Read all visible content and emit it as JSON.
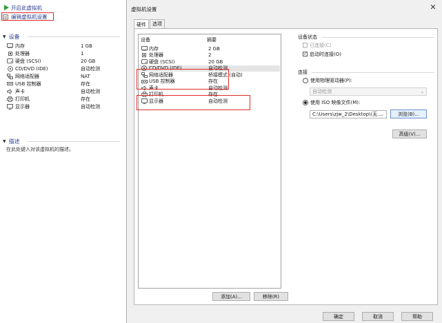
{
  "left": {
    "actions": {
      "power_on": "开启此虚拟机",
      "edit": "编辑虚拟机设置"
    },
    "devices_header": "设备",
    "devices": [
      {
        "icon": "memory-icon",
        "name": "内存",
        "value": "1 GB"
      },
      {
        "icon": "processor-icon",
        "name": "处理器",
        "value": "1"
      },
      {
        "icon": "hard-disk-icon",
        "name": "硬盘 (SCSI)",
        "value": "20 GB"
      },
      {
        "icon": "cd-dvd-icon",
        "name": "CD/DVD (IDE)",
        "value": "自动检测"
      },
      {
        "icon": "network-adapter-icon",
        "name": "网络适配器",
        "value": "NAT"
      },
      {
        "icon": "usb-icon",
        "name": "USB 控制器",
        "value": "存在"
      },
      {
        "icon": "sound-card-icon",
        "name": "声卡",
        "value": "自动检测"
      },
      {
        "icon": "printer-icon",
        "name": "打印机",
        "value": "存在"
      },
      {
        "icon": "display-icon",
        "name": "显示器",
        "value": "自动检测"
      }
    ],
    "description_header": "描述",
    "description_text": "在此处键入对该虚拟机的描述。"
  },
  "dialog": {
    "title": "虚拟机设置",
    "close_glyph": "✕",
    "tabs": [
      {
        "label": "硬件",
        "active": true
      },
      {
        "label": "选项",
        "active": false
      }
    ],
    "device_list": {
      "col_device": "设备",
      "col_summary": "摘要",
      "rows": [
        {
          "icon": "memory-icon",
          "name": "内存",
          "summary": "2 GB"
        },
        {
          "icon": "processor-icon",
          "name": "处理器",
          "summary": "2"
        },
        {
          "icon": "hard-disk-icon",
          "name": "硬盘 (SCSI)",
          "summary": "20 GB"
        },
        {
          "icon": "cd-dvd-icon",
          "name": "CD/DVD (IDE)",
          "summary": "自动检测",
          "selected": true
        },
        {
          "icon": "network-adapter-icon",
          "name": "网络适配器",
          "summary": "桥接模式 (自动)"
        },
        {
          "icon": "usb-icon",
          "name": "USB 控制器",
          "summary": "存在"
        },
        {
          "icon": "sound-card-icon",
          "name": "声卡",
          "summary": "自动检测"
        },
        {
          "icon": "printer-icon",
          "name": "打印机",
          "summary": "存在"
        },
        {
          "icon": "display-icon",
          "name": "显示器",
          "summary": "自动检测"
        }
      ],
      "add_button": "添加(A)...",
      "remove_button": "移除(R)"
    },
    "device_status": {
      "label": "设备状态",
      "connected": {
        "label": "已连接(C)",
        "checked": false,
        "disabled": true
      },
      "connect_at_power_on": {
        "label": "启动时连接(O)",
        "checked": true,
        "disabled": false
      }
    },
    "connection": {
      "label": "连接",
      "physical_drive": {
        "label": "使用物理驱动器(P):",
        "selected": false
      },
      "physical_drive_value": "自动检测",
      "iso_image": {
        "label": "使用 ISO 映像文件(M):",
        "selected": true
      },
      "iso_path": "C:\\Users\\zjw_2\\Desktop\\(无...",
      "browse_button": "浏览(B)..."
    },
    "advanced_button": "高级(V)...",
    "footer": {
      "ok": "确定",
      "cancel": "取消",
      "help": "帮助"
    }
  },
  "colors": {
    "highlight_box": "#e02828",
    "link_text": "#2a3f8f",
    "dialog_bg": "#f0f0f0",
    "selected_row": "#e5e5e5"
  }
}
